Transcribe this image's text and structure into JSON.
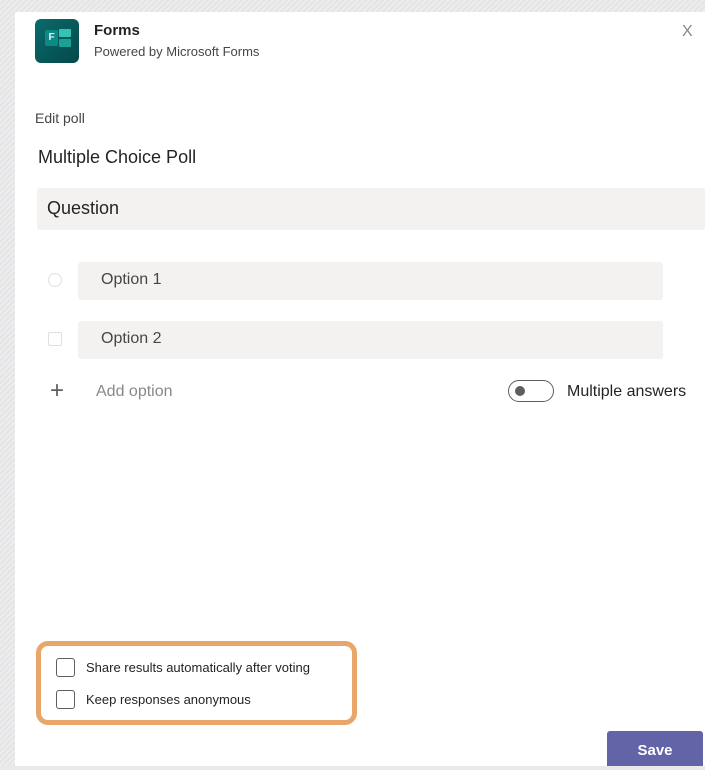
{
  "app": {
    "name": "Forms",
    "subtitle": "Powered by Microsoft Forms"
  },
  "close_icon": "close-icon",
  "close_glyph": "X",
  "section_label": "Edit poll",
  "poll_title": "Multiple Choice Poll",
  "question": {
    "placeholder": "Question"
  },
  "options": [
    {
      "placeholder": "Option 1",
      "marker": "radio"
    },
    {
      "placeholder": "Option 2",
      "marker": "square"
    }
  ],
  "add_option": {
    "icon": "plus-icon",
    "glyph": "+",
    "label": "Add option"
  },
  "multiple_answers": {
    "label": "Multiple answers",
    "enabled": false
  },
  "settings": [
    {
      "label": "Share results automatically after voting",
      "checked": false
    },
    {
      "label": "Keep responses anonymous",
      "checked": false
    }
  ],
  "save_label": "Save",
  "colors": {
    "accent": "#6264a7",
    "highlight": "#e8a66b",
    "app_icon": "#0b6a6b"
  }
}
